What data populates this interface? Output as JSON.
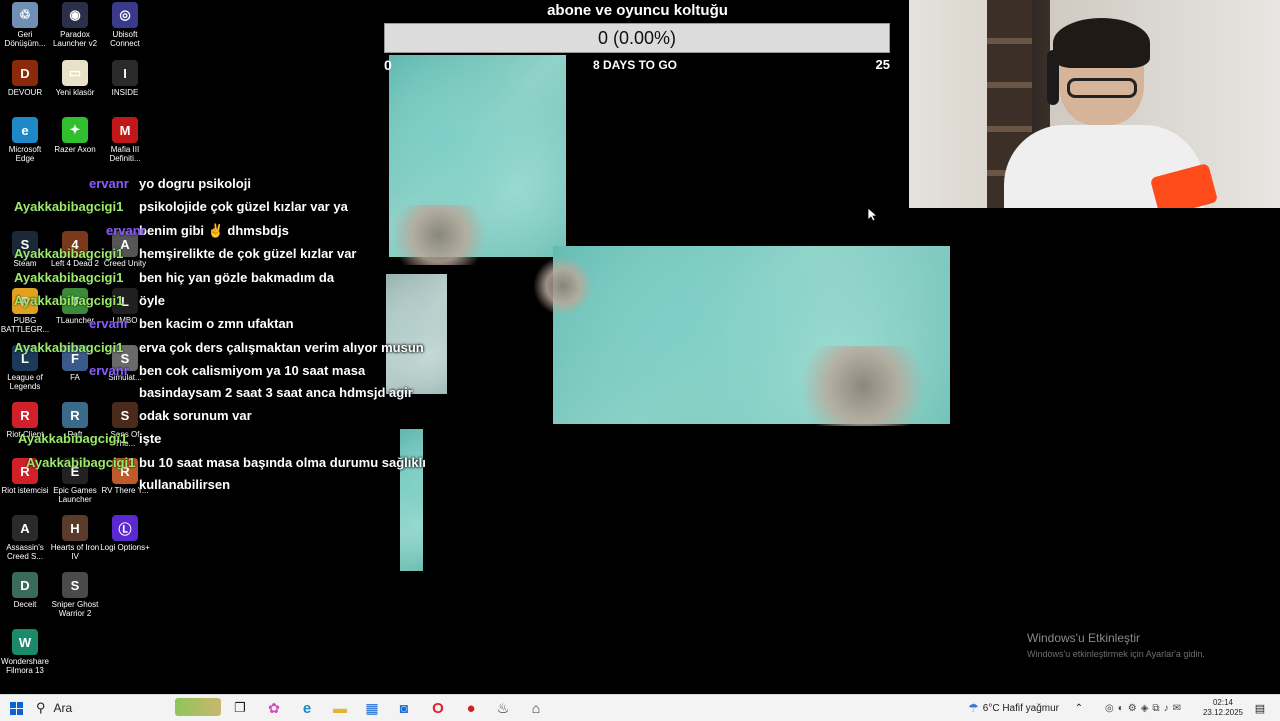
{
  "desktop": {
    "icons": [
      {
        "label": "Geri Dönüşüm...",
        "glyph": "♲",
        "color": "#6f8fb5"
      },
      {
        "label": "Paradox Launcher v2",
        "glyph": "◉",
        "color": "#2a2f4a"
      },
      {
        "label": "Ubisoft Connect",
        "glyph": "◎",
        "color": "#3a3a8a"
      },
      {
        "label": "DEVOUR",
        "glyph": "D",
        "color": "#8a2a0a"
      },
      {
        "label": "Yeni klasör",
        "glyph": "▭",
        "color": "#e9e2c8"
      },
      {
        "label": "INSIDE",
        "glyph": "I",
        "color": "#2a2a2a"
      },
      {
        "label": "Microsoft Edge",
        "glyph": "e",
        "color": "#1e88c8"
      },
      {
        "label": "Razer Axon",
        "glyph": "✦",
        "color": "#2fbf2f"
      },
      {
        "label": "Mafia III Definiti...",
        "glyph": "M",
        "color": "#c01818"
      },
      {
        "label": "Steam",
        "glyph": "S",
        "color": "#1b2838"
      },
      {
        "label": "Left 4 Dead 2",
        "glyph": "4",
        "color": "#7a3a1a"
      },
      {
        "label": "Creed Unity",
        "glyph": "A",
        "color": "#555555"
      },
      {
        "label": "PUBG BATTLEGR...",
        "glyph": "P",
        "color": "#e0a020"
      },
      {
        "label": "TLauncher",
        "glyph": "T",
        "color": "#3a8a3a"
      },
      {
        "label": "LIMBO",
        "glyph": "L",
        "color": "#202020"
      },
      {
        "label": "League of Legends",
        "glyph": "L",
        "color": "#1a3a5a"
      },
      {
        "label": "FA",
        "glyph": "F",
        "color": "#3a5a8a"
      },
      {
        "label": "Simulat...",
        "glyph": "S",
        "color": "#6a6a6a"
      },
      {
        "label": "Riot Client",
        "glyph": "R",
        "color": "#d0202a"
      },
      {
        "label": "Raft",
        "glyph": "R",
        "color": "#3a6a8a"
      },
      {
        "label": "Sons Of The...",
        "glyph": "S",
        "color": "#4a2a1a"
      },
      {
        "label": "Riot istemcisi",
        "glyph": "R",
        "color": "#d0202a"
      },
      {
        "label": "Epic Games Launcher",
        "glyph": "E",
        "color": "#222222"
      },
      {
        "label": "RV There Y...",
        "glyph": "R",
        "color": "#c05a2a"
      },
      {
        "label": "Assassin's Creed S...",
        "glyph": "A",
        "color": "#2a2a2a"
      },
      {
        "label": "Hearts of Iron IV",
        "glyph": "H",
        "color": "#5a3a2a"
      },
      {
        "label": "Logi Options+",
        "glyph": "Ⓛ",
        "color": "#5a2ad0"
      },
      {
        "label": "Deceit",
        "glyph": "D",
        "color": "#3a6a5a"
      },
      {
        "label": "Sniper Ghost Warrior 2",
        "glyph": "S",
        "color": "#4a4a4a"
      },
      {
        "label": "Wondershare Filmora 13",
        "glyph": "W",
        "color": "#1a8a6a"
      }
    ]
  },
  "goal": {
    "title": "abone ve oyuncu koltuğu",
    "progress_text": "0 (0.00%)",
    "progress_fraction": 0.0,
    "min": "0",
    "days_left": "8 DAYS TO GO",
    "max": "25"
  },
  "chat": {
    "users": [
      {
        "name": "ervanr",
        "color": "purple"
      },
      {
        "name": "Ayakkabibagcigi1",
        "color": "green"
      },
      {
        "name": "ervanr",
        "color": "purple"
      },
      {
        "name": "Ayakkabibagcigi1",
        "color": "green"
      },
      {
        "name": "Ayakkabibagcigi1",
        "color": "green"
      },
      {
        "name": "Ayakkabibagcigi1",
        "color": "green"
      },
      {
        "name": "ervanr",
        "color": "purple"
      },
      {
        "name": "Ayakkabibagcigi1",
        "color": "green"
      },
      {
        "name": "ervanr",
        "color": "purple"
      },
      {
        "name": "Ayakkabibagcigi1",
        "color": "green"
      },
      {
        "name": "Ayakkabibagcigi1",
        "color": "green"
      }
    ],
    "lines": [
      "yo dogru psikoloji",
      "psikolojide çok güzel kızlar var ya",
      "benim gibi ✌ dhmsbdjs",
      "hemşirelikte de çok güzel kızlar var",
      "ben hiç yan gözle bakmadım da",
      "öyle",
      "ben kacim o zmn ufaktan",
      "erva çok ders çalışmaktan verim alıyor musun",
      "ben cok calismiyom ya 10 saat masa",
      "basindaysam 2 saat 3 saat anca hdmsjd agir",
      "odak sorunum var",
      "işte",
      "bu 10 saat masa başında olma durumu sağlıklı",
      "kullanabilirsen"
    ]
  },
  "watermark": {
    "title": "Windows'u Etkinleştir",
    "subtitle": "Windows'u etkinleştirmek için Ayarlar'a gidin."
  },
  "taskbar": {
    "search_label": "Ara",
    "weather": "6°C  Hafif yağmur",
    "time": "02:14",
    "date": "23.12.2025"
  }
}
